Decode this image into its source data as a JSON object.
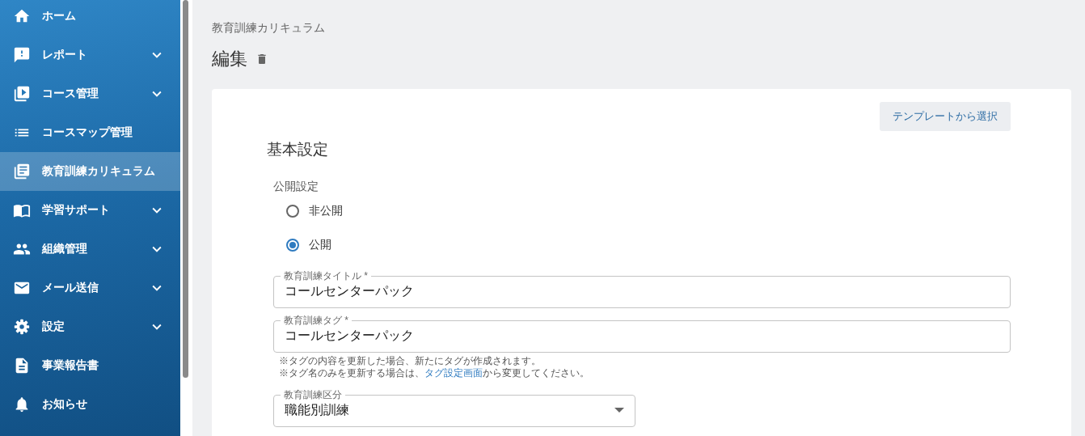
{
  "sidebar": {
    "items": [
      {
        "label": "ホーム",
        "expandable": false,
        "selected": false
      },
      {
        "label": "レポート",
        "expandable": true,
        "selected": false
      },
      {
        "label": "コース管理",
        "expandable": true,
        "selected": false
      },
      {
        "label": "コースマップ管理",
        "expandable": false,
        "selected": false
      },
      {
        "label": "教育訓練カリキュラム",
        "expandable": false,
        "selected": true
      },
      {
        "label": "学習サポート",
        "expandable": true,
        "selected": false
      },
      {
        "label": "組織管理",
        "expandable": true,
        "selected": false
      },
      {
        "label": "メール送信",
        "expandable": true,
        "selected": false
      },
      {
        "label": "設定",
        "expandable": true,
        "selected": false
      },
      {
        "label": "事業報告書",
        "expandable": false,
        "selected": false
      },
      {
        "label": "お知らせ",
        "expandable": false,
        "selected": false
      }
    ]
  },
  "breadcrumb": "教育訓練カリキュラム",
  "page_title": "編集",
  "form": {
    "template_button": "テンプレートから選択",
    "section_title": "基本設定",
    "visibility": {
      "label": "公開設定",
      "options": [
        {
          "label": "非公開",
          "selected": false
        },
        {
          "label": "公開",
          "selected": true
        }
      ]
    },
    "fields": [
      {
        "label": "教育訓練タイトル *",
        "value": "コールセンターパック"
      },
      {
        "label": "教育訓練タグ *",
        "value": "コールセンターパック"
      }
    ],
    "notes": [
      {
        "before": "※タグの内容を更新した場合、新たにタグが作成されます。"
      },
      {
        "before": "※タグ名のみを更新する場合は、",
        "link": "タグ設定画面",
        "after": "から変更してください。"
      }
    ],
    "select": {
      "label": "教育訓練区分",
      "value": "職能別訓練"
    }
  }
}
